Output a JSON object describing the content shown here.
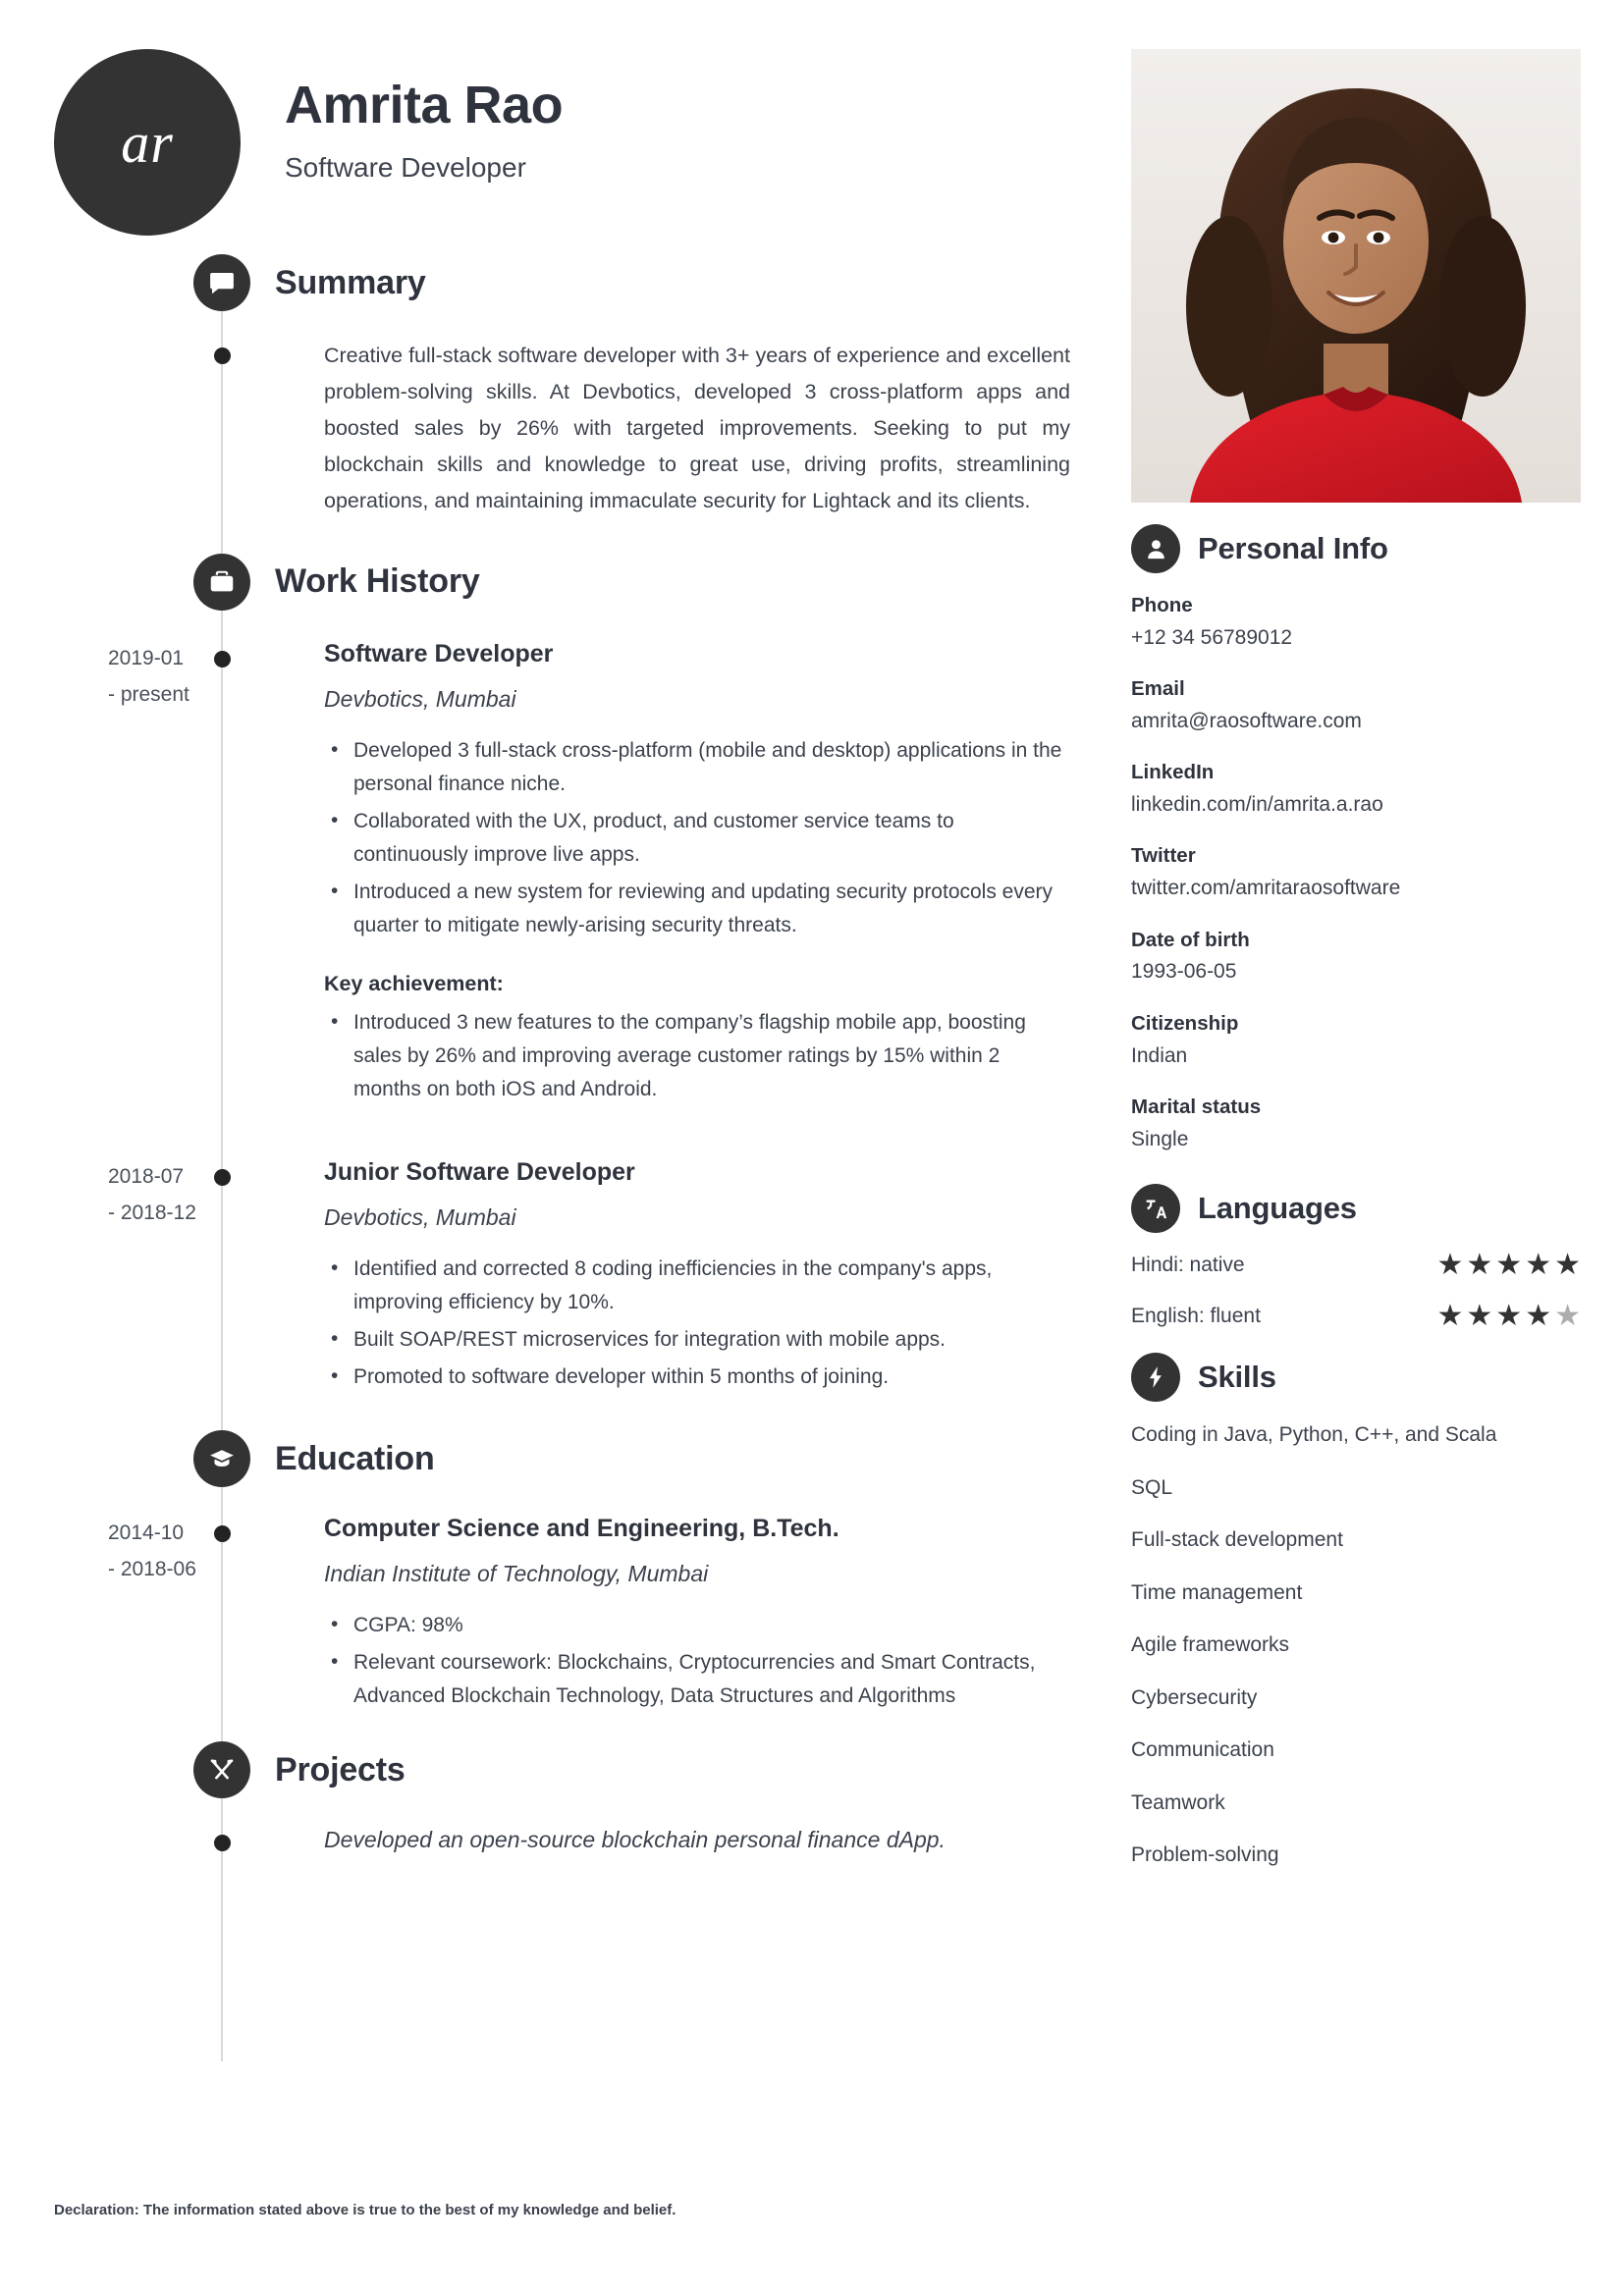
{
  "header": {
    "monogram": "ar",
    "name": "Amrita Rao",
    "title": "Software Developer"
  },
  "sections": {
    "summary": {
      "title": "Summary",
      "icon": "speech-bubble-icon",
      "text": "Creative full-stack software developer with 3+ years of experience and excellent problem-solving skills. At Devbotics, developed 3 cross-platform apps and boosted sales by 26% with targeted improvements. Seeking to put my blockchain skills and knowledge to great use, driving profits, streamlining operations, and maintaining immaculate security for Lightack and its clients."
    },
    "work_history": {
      "title": "Work History",
      "icon": "briefcase-icon",
      "entries": [
        {
          "date_start": "2019-01",
          "date_end": "- present",
          "role": "Software Developer",
          "org": "Devbotics, Mumbai",
          "bullets": [
            "Developed 3 full-stack cross-platform (mobile and desktop) applications in the personal finance niche.",
            "Collaborated with the UX, product, and customer service teams to continuously improve live apps.",
            "Introduced a new system for reviewing and updating security protocols every quarter to mitigate newly-arising security threats."
          ],
          "key_achievement_label": "Key achievement:",
          "key_achievements": [
            "Introduced 3 new features to the company’s flagship mobile app, boosting sales by 26% and improving average customer ratings by 15% within 2 months on both iOS and Android."
          ]
        },
        {
          "date_start": "2018-07",
          "date_end": "- 2018-12",
          "role": "Junior Software Developer",
          "org": "Devbotics, Mumbai",
          "bullets": [
            "Identified and corrected 8 coding inefficiencies in the company's apps, improving efficiency by 10%.",
            "Built SOAP/REST microservices for integration with mobile apps.",
            "Promoted to software developer within 5 months of joining."
          ]
        }
      ]
    },
    "education": {
      "title": "Education",
      "icon": "graduation-cap-icon",
      "entries": [
        {
          "date_start": "2014-10",
          "date_end": "- 2018-06",
          "degree": "Computer Science and Engineering, B.Tech.",
          "school": "Indian Institute of Technology, Mumbai",
          "bullets": [
            "CGPA: 98%",
            "Relevant coursework: Blockchains, Cryptocurrencies and Smart Contracts,  Advanced Blockchain Technology, Data Structures and Algorithms"
          ]
        }
      ]
    },
    "projects": {
      "title": "Projects",
      "icon": "tools-icon",
      "items": [
        "Developed an open-source blockchain personal finance dApp."
      ]
    }
  },
  "sidebar": {
    "photo": {
      "alt": "profile-photo"
    },
    "personal_info": {
      "title": "Personal Info",
      "icon": "person-icon",
      "items": [
        {
          "label": "Phone",
          "value": "+12 34 56789012"
        },
        {
          "label": "Email",
          "value": "amrita@raosoftware.com"
        },
        {
          "label": "LinkedIn",
          "value": "linkedin.com/in/amrita.a.rao"
        },
        {
          "label": "Twitter",
          "value": "twitter.com/amritaraosoftware"
        },
        {
          "label": "Date of birth",
          "value": "1993-06-05"
        },
        {
          "label": "Citizenship",
          "value": "Indian"
        },
        {
          "label": "Marital status",
          "value": "Single"
        }
      ]
    },
    "languages": {
      "title": "Languages",
      "icon": "translate-icon",
      "items": [
        {
          "label": "Hindi: native",
          "rating": 5,
          "max": 5
        },
        {
          "label": "English: fluent",
          "rating": 4,
          "max": 5
        }
      ]
    },
    "skills": {
      "title": "Skills",
      "icon": "lightning-bolt-icon",
      "items": [
        "Coding in Java, Python, C++, and Scala",
        "SQL",
        "Full-stack development",
        "Time management",
        "Agile frameworks",
        "Cybersecurity",
        "Communication",
        "Teamwork",
        "Problem-solving"
      ]
    }
  },
  "footer": {
    "declaration": "Declaration: The information stated above is true to the best of my knowledge and belief."
  },
  "colors": {
    "accent": "#333333",
    "text": "#3c424d",
    "heading": "#2e333d",
    "timeline": "#d9d9d9",
    "star_on": "#333333",
    "star_off": "#adadad"
  }
}
